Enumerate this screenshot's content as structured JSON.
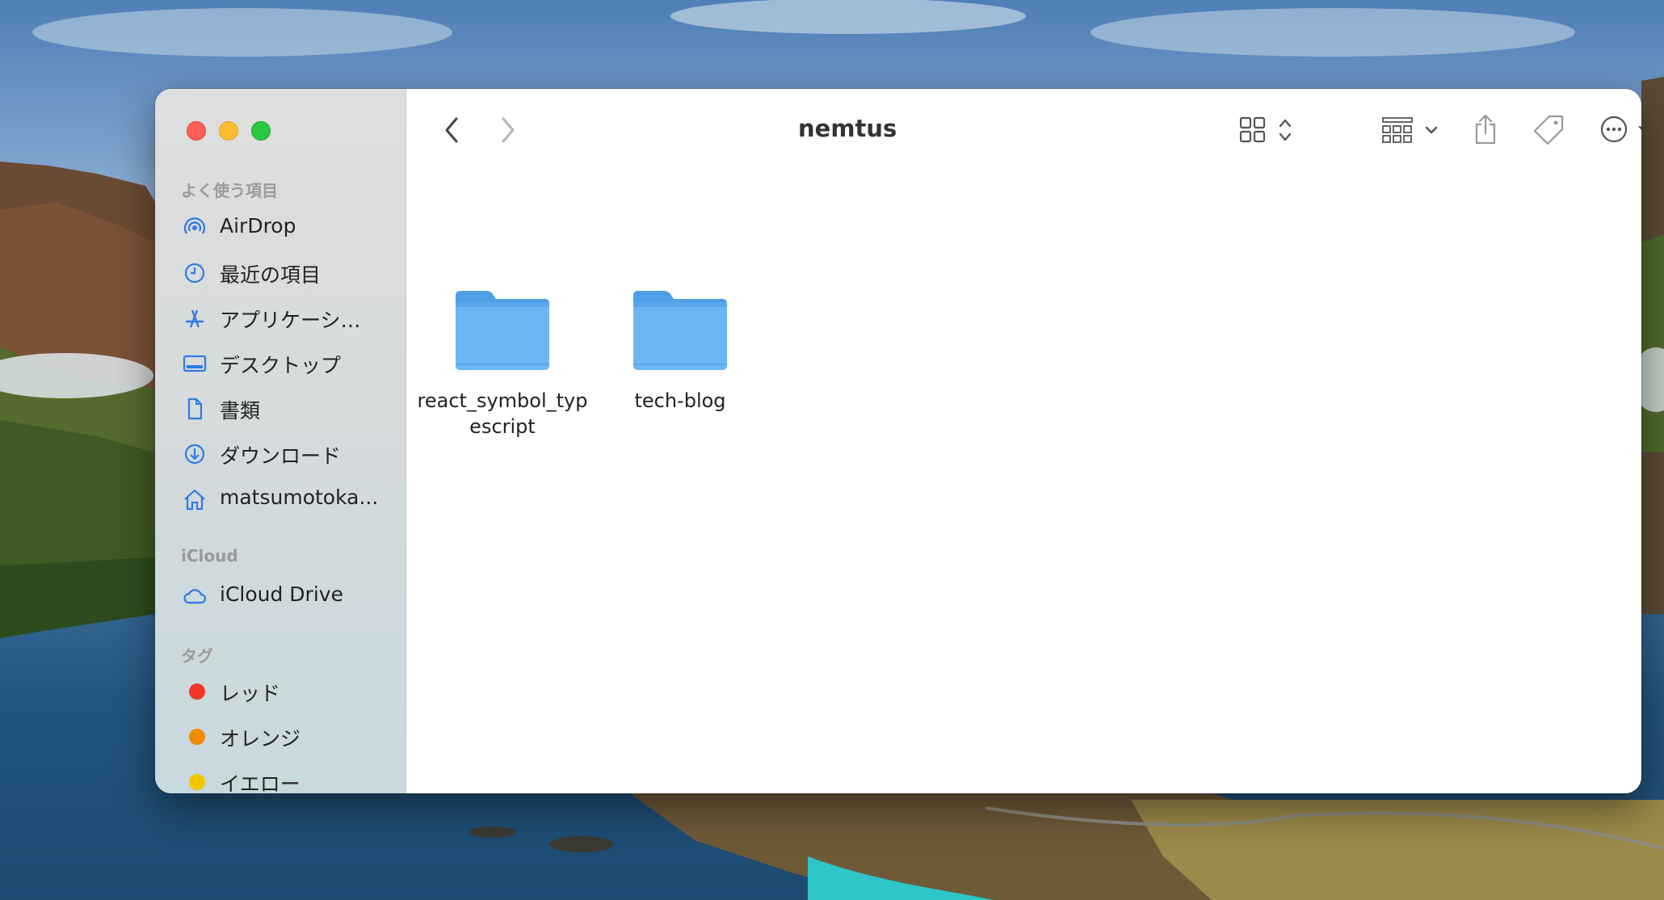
{
  "window": {
    "title": "nemtus"
  },
  "sidebar": {
    "sections": {
      "favorites": "よく使う項目",
      "icloud": "iCloud",
      "tags": "タグ"
    },
    "favorites": [
      {
        "label": "AirDrop",
        "icon": "airdrop-icon"
      },
      {
        "label": "最近の項目",
        "icon": "clock-icon"
      },
      {
        "label": "アプリケーシ…",
        "icon": "applications-icon"
      },
      {
        "label": "デスクトップ",
        "icon": "desktop-icon"
      },
      {
        "label": "書類",
        "icon": "document-icon"
      },
      {
        "label": "ダウンロード",
        "icon": "download-icon"
      },
      {
        "label": "matsumotoka...",
        "icon": "home-icon"
      }
    ],
    "icloud": [
      {
        "label": "iCloud Drive",
        "icon": "cloud-icon"
      }
    ],
    "tags": [
      {
        "label": "レッド",
        "color": "#f1362c"
      },
      {
        "label": "オレンジ",
        "color": "#f08a00"
      },
      {
        "label": "イエロー",
        "color": "#f5c400"
      }
    ]
  },
  "toolbar": {
    "back_icon": "chevron-left-icon",
    "forward_icon": "chevron-right-icon",
    "view_icon": "icon-grid-icon",
    "group_icon": "group-icon",
    "share_icon": "share-icon",
    "tag_icon": "tag-icon",
    "more_icon": "ellipsis-circle-icon",
    "search_icon": "search-icon"
  },
  "files": [
    {
      "name": "react_symbol_typescript",
      "icon": "folder-icon"
    },
    {
      "name": "tech-blog",
      "icon": "folder-icon"
    }
  ],
  "colors": {
    "accent": "#2f7ae5",
    "folder": "#6cb6f3"
  }
}
